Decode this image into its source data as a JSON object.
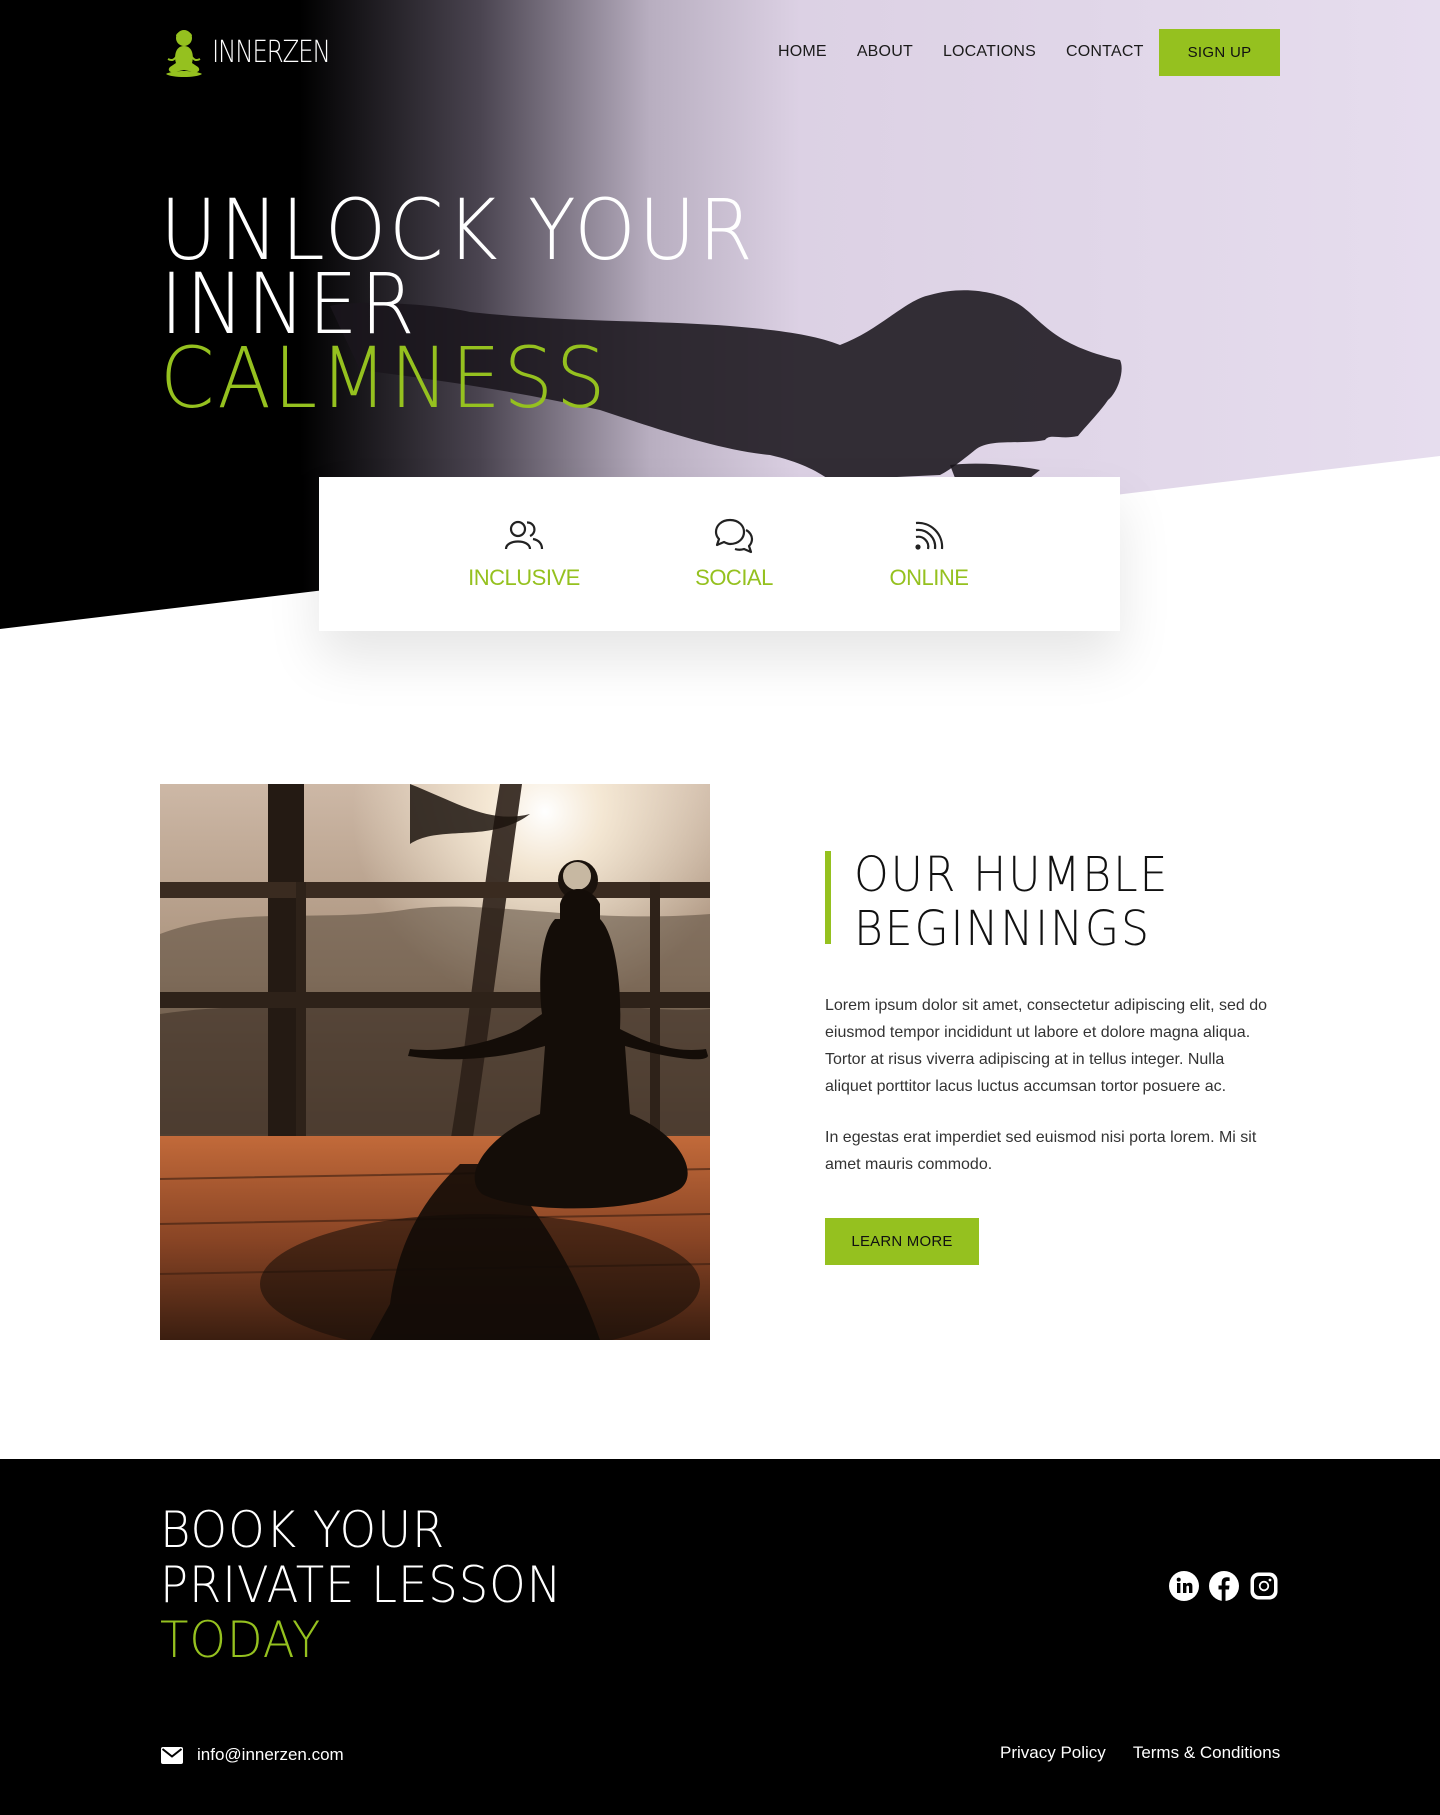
{
  "brand": {
    "name": "INNERZEN",
    "accent_color": "#95c11f"
  },
  "nav": {
    "items": [
      {
        "label": "HOME"
      },
      {
        "label": "ABOUT"
      },
      {
        "label": "LOCATIONS"
      },
      {
        "label": "CONTACT"
      }
    ],
    "cta_label": "SIGN UP"
  },
  "hero": {
    "lines": [
      "UNLOCK YOUR",
      "INNER",
      "CALMNESS"
    ]
  },
  "features": [
    {
      "label": "INCLUSIVE",
      "icon": "users-icon"
    },
    {
      "label": "SOCIAL",
      "icon": "chat-bubbles-icon"
    },
    {
      "label": "ONLINE",
      "icon": "rss-icon"
    }
  ],
  "about": {
    "title_lines": [
      "OUR HUMBLE",
      "BEGINNINGS"
    ],
    "paragraphs": [
      "Lorem ipsum dolor sit amet, consectetur adipiscing elit, sed do eiusmod tempor incididunt ut labore et dolore magna aliqua. Tortor at risus viverra adipiscing at in tellus integer. Nulla aliquet porttitor lacus luctus accumsan tortor posuere ac.",
      "In egestas erat imperdiet sed euismod nisi porta lorem. Mi sit amet mauris commodo."
    ],
    "button_label": "LEARN MORE"
  },
  "footer": {
    "book_lines": [
      "BOOK YOUR",
      "PRIVATE LESSON",
      "TODAY"
    ],
    "social": [
      "linkedin-icon",
      "facebook-icon",
      "instagram-icon"
    ],
    "email": "info@innerzen.com",
    "links": [
      {
        "label": "Privacy Policy"
      },
      {
        "label": "Terms & Conditions"
      }
    ]
  }
}
